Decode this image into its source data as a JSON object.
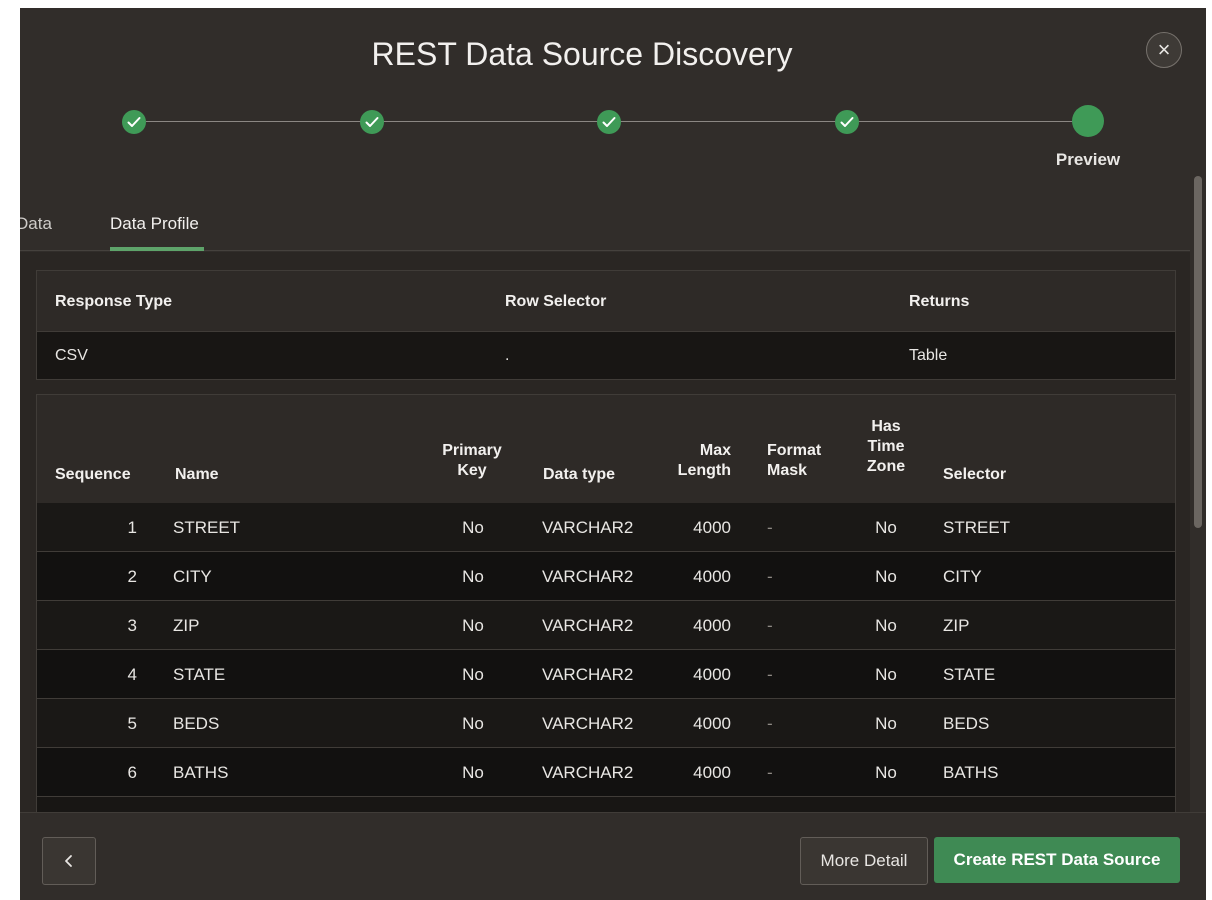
{
  "dialog": {
    "title": "REST Data Source Discovery",
    "close_icon": "close-icon"
  },
  "wizard": {
    "steps_completed": 4,
    "current_step_label": "Preview"
  },
  "tabs": [
    {
      "label": "Data",
      "active": false
    },
    {
      "label": "Data Profile",
      "active": true
    }
  ],
  "profile": {
    "headers": [
      "Response Type",
      "Row Selector",
      "Returns"
    ],
    "values": [
      "CSV",
      ".",
      "Table"
    ]
  },
  "columns_table": {
    "headers": {
      "sequence": "Sequence",
      "name": "Name",
      "primary_key_1": "Primary",
      "primary_key_2": "Key",
      "data_type": "Data type",
      "max_length_1": "Max",
      "max_length_2": "Length",
      "format_mask_1": "Format",
      "format_mask_2": "Mask",
      "has_tz_1": "Has",
      "has_tz_2": "Time",
      "has_tz_3": "Zone",
      "selector": "Selector"
    },
    "rows": [
      {
        "seq": "1",
        "name": "STREET",
        "pk": "No",
        "type": "VARCHAR2",
        "len": "4000",
        "mask": "-",
        "tz": "No",
        "selector": "STREET"
      },
      {
        "seq": "2",
        "name": "CITY",
        "pk": "No",
        "type": "VARCHAR2",
        "len": "4000",
        "mask": "-",
        "tz": "No",
        "selector": "CITY"
      },
      {
        "seq": "3",
        "name": "ZIP",
        "pk": "No",
        "type": "VARCHAR2",
        "len": "4000",
        "mask": "-",
        "tz": "No",
        "selector": "ZIP"
      },
      {
        "seq": "4",
        "name": "STATE",
        "pk": "No",
        "type": "VARCHAR2",
        "len": "4000",
        "mask": "-",
        "tz": "No",
        "selector": "STATE"
      },
      {
        "seq": "5",
        "name": "BEDS",
        "pk": "No",
        "type": "VARCHAR2",
        "len": "4000",
        "mask": "-",
        "tz": "No",
        "selector": "BEDS"
      },
      {
        "seq": "6",
        "name": "BATHS",
        "pk": "No",
        "type": "VARCHAR2",
        "len": "4000",
        "mask": "-",
        "tz": "No",
        "selector": "BATHS"
      }
    ]
  },
  "footer": {
    "back_icon": "chevron-left-icon",
    "more_detail_label": "More Detail",
    "create_label": "Create REST Data Source"
  },
  "colors": {
    "accent_green": "#3f8a54",
    "dialog_bg": "#312d2a"
  }
}
